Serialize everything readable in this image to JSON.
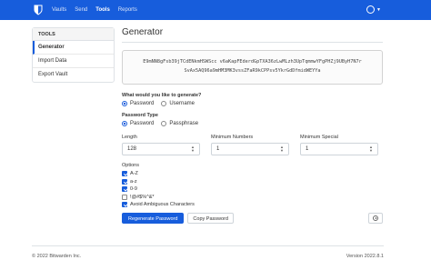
{
  "nav": {
    "links": [
      "Vaults",
      "Send",
      "Tools",
      "Reports"
    ],
    "active": "Tools"
  },
  "sidebar": {
    "header": "TOOLS",
    "items": [
      {
        "label": "Generator",
        "active": true
      },
      {
        "label": "Import Data",
        "active": false
      },
      {
        "label": "Export Vault",
        "active": false
      }
    ]
  },
  "main": {
    "title": "Generator",
    "password_line1": "E9mNN8gFsb39jTCdENkmHSWScc v6aKapFEderdGpTXA36zLwMLzh3UpTqmmwYFgPHZj9UByH7N7r",
    "password_line2": "SvAx5AQ96a9mHM3MK3vssZFaR9kCPPsv5YkrGdDfmidWEYYa",
    "what_label": "What would you like to generate?",
    "what_options": [
      "Password",
      "Username"
    ],
    "type_label": "Password Type",
    "type_options": [
      "Password",
      "Passphrase"
    ],
    "length_label": "Length",
    "length_value": "128",
    "min_numbers_label": "Minimum Numbers",
    "min_numbers_value": "1",
    "min_special_label": "Minimum Special",
    "min_special_value": "1",
    "options_label": "Options",
    "options": [
      {
        "label": "A-Z",
        "checked": true
      },
      {
        "label": "a-z",
        "checked": true
      },
      {
        "label": "0-9",
        "checked": true
      },
      {
        "label": "!@#$%^&*",
        "checked": false
      },
      {
        "label": "Avoid Ambiguous Characters",
        "checked": true
      }
    ],
    "regenerate_label": "Regenerate Password",
    "copy_label": "Copy Password"
  },
  "footer": {
    "copyright": "© 2022 Bitwarden Inc.",
    "version": "Version 2022.8.1"
  },
  "colors": {
    "brand": "#175ddc"
  }
}
